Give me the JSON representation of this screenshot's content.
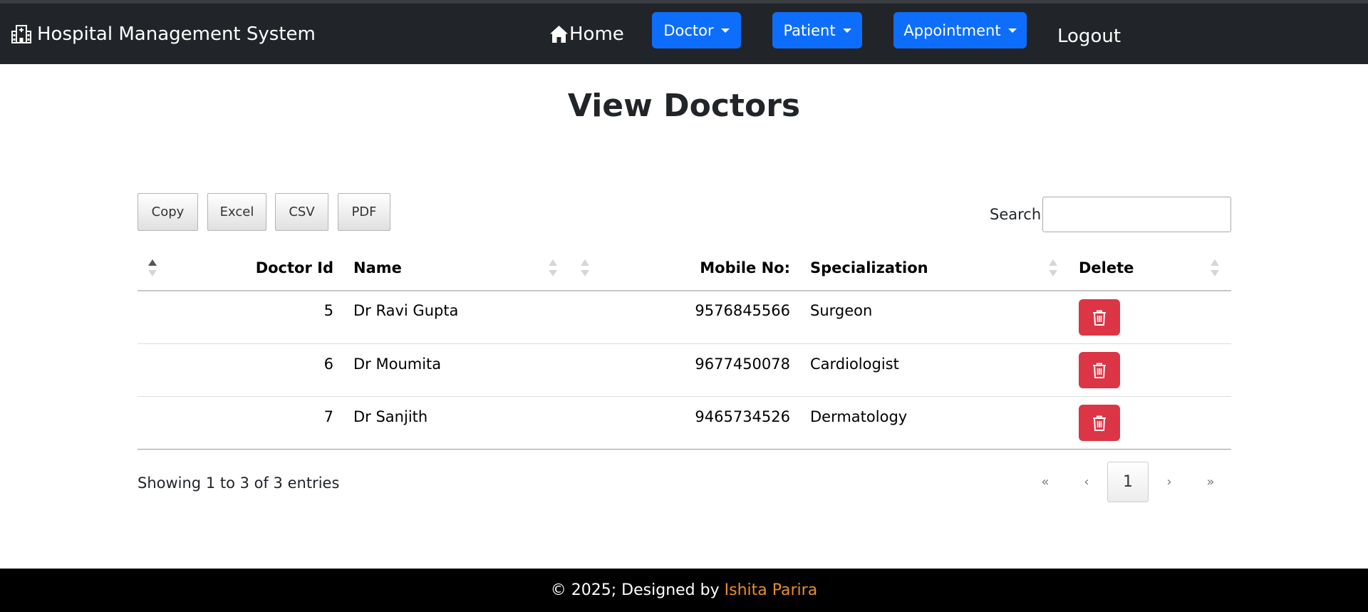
{
  "navbar": {
    "brand": "Hospital Management System",
    "home_label": "Home",
    "doctor_label": "Doctor",
    "patient_label": "Patient",
    "appointment_label": "Appointment",
    "logout_label": "Logout",
    "background_color": "#212529",
    "button_color": "#0d6efd"
  },
  "page": {
    "title": "View Doctors"
  },
  "export_buttons": {
    "copy": "Copy",
    "excel": "Excel",
    "csv": "CSV",
    "pdf": "PDF"
  },
  "search": {
    "label": "Search:",
    "value": "",
    "placeholder": ""
  },
  "table": {
    "columns": {
      "doctor_id": "Doctor Id",
      "name": "Name",
      "mobile": "Mobile No:",
      "specialization": "Specialization",
      "delete": "Delete"
    },
    "sorted_column": "Doctor Id",
    "sort_direction": "ascending",
    "rows": [
      {
        "id": "5",
        "name": "Dr Ravi Gupta",
        "mobile": "9576845566",
        "specialization": "Surgeon"
      },
      {
        "id": "6",
        "name": "Dr Moumita",
        "mobile": "9677450078",
        "specialization": "Cardiologist"
      },
      {
        "id": "7",
        "name": "Dr Sanjith",
        "mobile": "9465734526",
        "specialization": "Dermatology"
      }
    ],
    "delete_icon": "trash-icon",
    "delete_color": "#dc3545"
  },
  "info": {
    "text": "Showing 1 to 3 of 3 entries"
  },
  "pagination": {
    "first": "«",
    "previous": "‹",
    "current": "1",
    "next": "›",
    "last": "»"
  },
  "footer": {
    "prefix": "© 2025; Designed by ",
    "author": "Ishita Parira",
    "author_color": "#e88e2e"
  }
}
